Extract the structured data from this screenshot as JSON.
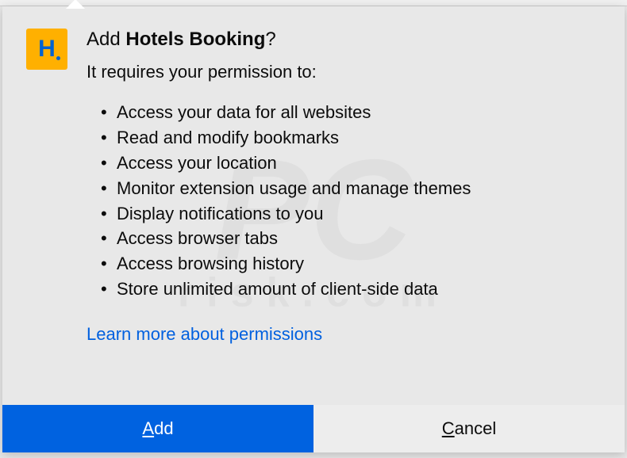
{
  "dialog": {
    "add_prefix": "Add ",
    "ext_name": "Hotels Booking",
    "add_suffix": "?",
    "subtitle": "It requires your permission to:",
    "icon_letter": "H",
    "permissions": [
      "Access your data for all websites",
      "Read and modify bookmarks",
      "Access your location",
      "Monitor extension usage and manage themes",
      "Display notifications to you",
      "Access browser tabs",
      "Access browsing history",
      "Store unlimited amount of client-side data"
    ],
    "learn_more": "Learn more about permissions",
    "add_btn_accel": "A",
    "add_btn_rest": "dd",
    "cancel_btn_accel": "C",
    "cancel_btn_rest": "ancel"
  }
}
